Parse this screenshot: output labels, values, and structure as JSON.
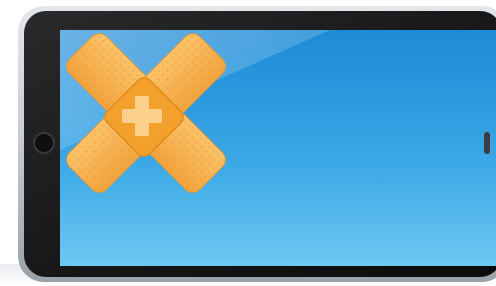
{
  "scene": {
    "subject": "tablet-with-bandage",
    "colors": {
      "bezel": "#1b1b1c",
      "frame": "#c9cdd2",
      "screen_top": "#1e8fd8",
      "screen_bottom": "#5cc0ef",
      "bandage": "#f5b04a",
      "bandage_pad": "#f7a12e",
      "cross": "#fbd08a"
    },
    "icons": [
      "home-button-icon",
      "camera-icon",
      "first-aid-cross-icon"
    ]
  }
}
